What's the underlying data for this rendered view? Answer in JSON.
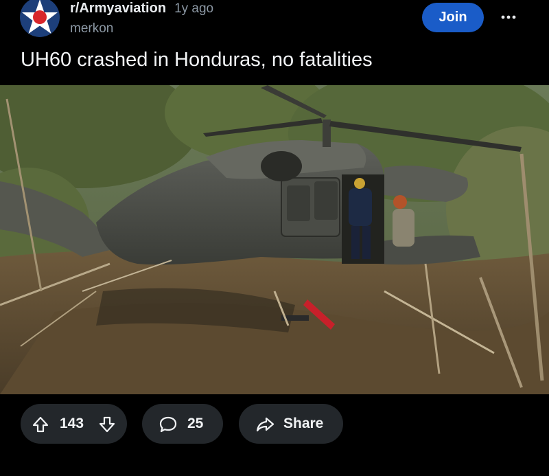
{
  "post": {
    "subreddit": "r/Armyaviation",
    "age": "1y ago",
    "author": "merkon",
    "join_label": "Join",
    "more_icon": "more-dots-icon",
    "title": "UH60 crashed in Honduras, no fatalities"
  },
  "actions": {
    "upvote_icon": "upvote-arrow-icon",
    "score": "143",
    "downvote_icon": "downvote-arrow-icon",
    "comment_icon": "comment-bubble-icon",
    "comments": "25",
    "share_icon": "share-arrow-icon",
    "share_label": "Share"
  },
  "colors": {
    "background": "#000000",
    "join_button": "#1a5cc8",
    "pill": "#23272b",
    "muted_text": "#8b97a3"
  }
}
